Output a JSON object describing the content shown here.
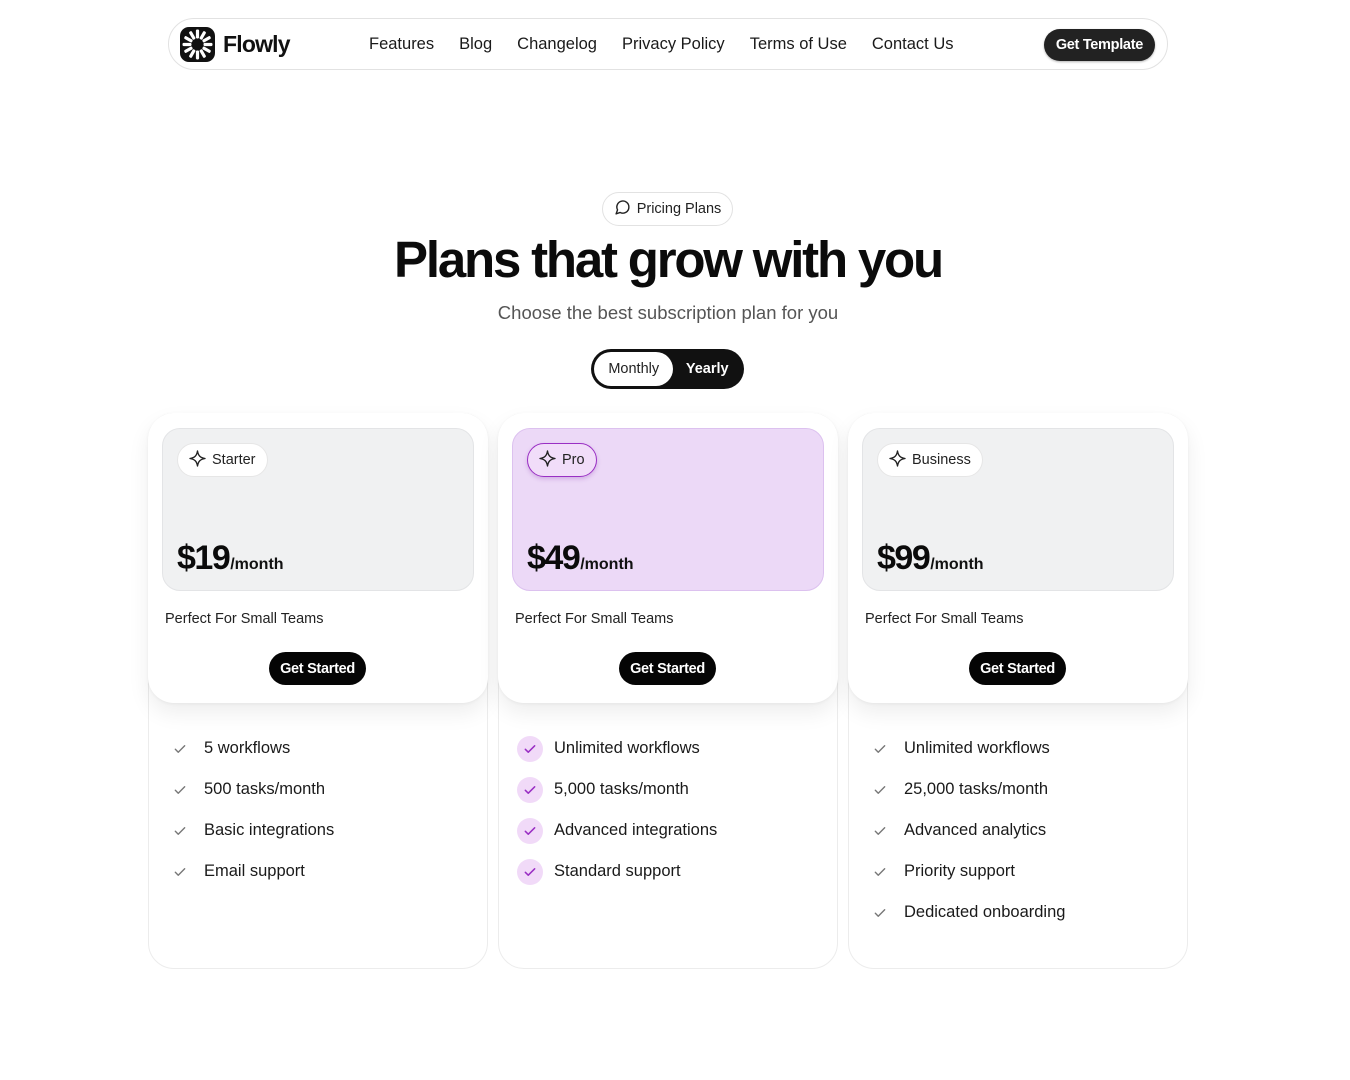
{
  "nav": {
    "brand": "Flowly",
    "links": [
      "Features",
      "Blog",
      "Changelog",
      "Privacy Policy",
      "Terms of Use",
      "Contact Us"
    ],
    "cta": "Get Template"
  },
  "hero": {
    "badge": "Pricing Plans",
    "title": "Plans that grow with you",
    "subtitle": "Choose the best subscription plan for you",
    "toggle": {
      "monthly": "Monthly",
      "yearly": "Yearly",
      "selected": "Yearly"
    }
  },
  "colors": {
    "accent": "#9a2fc4",
    "pro_bg": "#ecd9f7",
    "dark": "#111111"
  },
  "plans": [
    {
      "name": "Starter",
      "price": "$19",
      "period": "/month",
      "description": "Perfect For Small Teams",
      "cta": "Get Started",
      "features": [
        "5 workflows",
        "500 tasks/month",
        "Basic integrations",
        "Email support"
      ]
    },
    {
      "name": "Pro",
      "price": "$49",
      "period": "/month",
      "description": "Perfect For Small Teams",
      "cta": "Get Started",
      "features": [
        "Unlimited workflows",
        "5,000 tasks/month",
        "Advanced integrations",
        "Standard support"
      ]
    },
    {
      "name": "Business",
      "price": "$99",
      "period": "/month",
      "description": "Perfect For Small Teams",
      "cta": "Get Started",
      "features": [
        "Unlimited workflows",
        "25,000 tasks/month",
        "Advanced analytics",
        "Priority support",
        "Dedicated onboarding"
      ]
    }
  ]
}
